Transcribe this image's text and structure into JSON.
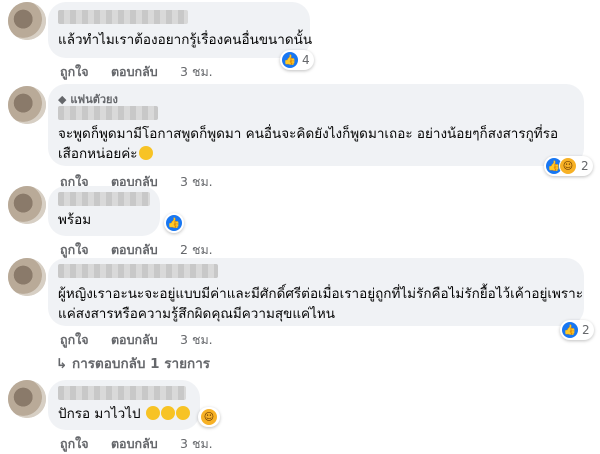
{
  "comments": [
    {
      "text": "แล้วทำไมเราต้องอยากรู้เรื่องคนอื่นขนาดนั้น",
      "like": "ถูกใจ",
      "reply": "ตอบกลับ",
      "time": "3 ชม.",
      "reaction_count": "4"
    },
    {
      "badge": "แฟนตัวยง",
      "line1": "จะพูดก็พูดมามีโอกาสพูดก็พูดมา คนอื่นจะคิดยังไงก็พูดมาเถอะ อย่างน้อยๆก็สงสารกูที่รอ",
      "line2": "เสือกหน่อยค่ะ",
      "like": "ถูกใจ",
      "reply": "ตอบกลับ",
      "time": "3 ชม.",
      "reaction_count": "2"
    },
    {
      "text": "พร้อม",
      "like": "ถูกใจ",
      "reply": "ตอบกลับ",
      "time": "2 ชม."
    },
    {
      "line1": "ผู้หญิงเราอะนะจะอยู่แบบมีค่าและมีศักดิ์ศรีต่อเมื่อเราอยู่ถูกที่ไม่รักคือไม่รักยื้อไว้เค้าอยู่เพราะ",
      "line2": "แค่สงสารหรือความรู้สึกผิดคุณมีความสุขแค่ไหน",
      "like": "ถูกใจ",
      "reply": "ตอบกลับ",
      "time": "3 ชม.",
      "reaction_count": "2",
      "replies_label": "การตอบกลับ 1 รายการ"
    },
    {
      "text": "ปักรอ มาไวไป",
      "like": "ถูกใจ",
      "reply": "ตอบกลับ",
      "time": "3 ชม."
    }
  ],
  "icons": {
    "like": "like-icon",
    "haha": "haha-icon",
    "reply_arrow": "reply-arrow-icon"
  },
  "colors": {
    "bubble": "#f0f2f5",
    "like_blue": "#1877f2",
    "haha_yellow": "#f7b125",
    "meta_gray": "#65676b"
  }
}
